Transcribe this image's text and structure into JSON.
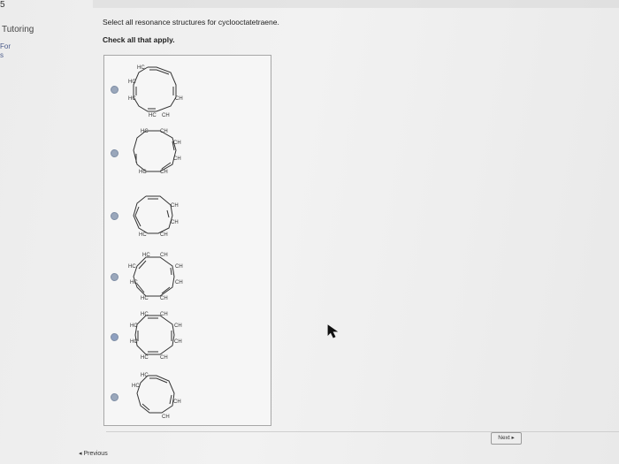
{
  "sidebar": {
    "top_char": "5",
    "tutoring": "Tutoring",
    "line1": "For",
    "line2": "s"
  },
  "question": {
    "prompt": "Select all resonance structures for cyclooctatetraene.",
    "instruction": "Check all that apply."
  },
  "labels": {
    "hc": "HC",
    "ch": "CH"
  },
  "footer": {
    "next": "Next",
    "previous": "Previous"
  }
}
